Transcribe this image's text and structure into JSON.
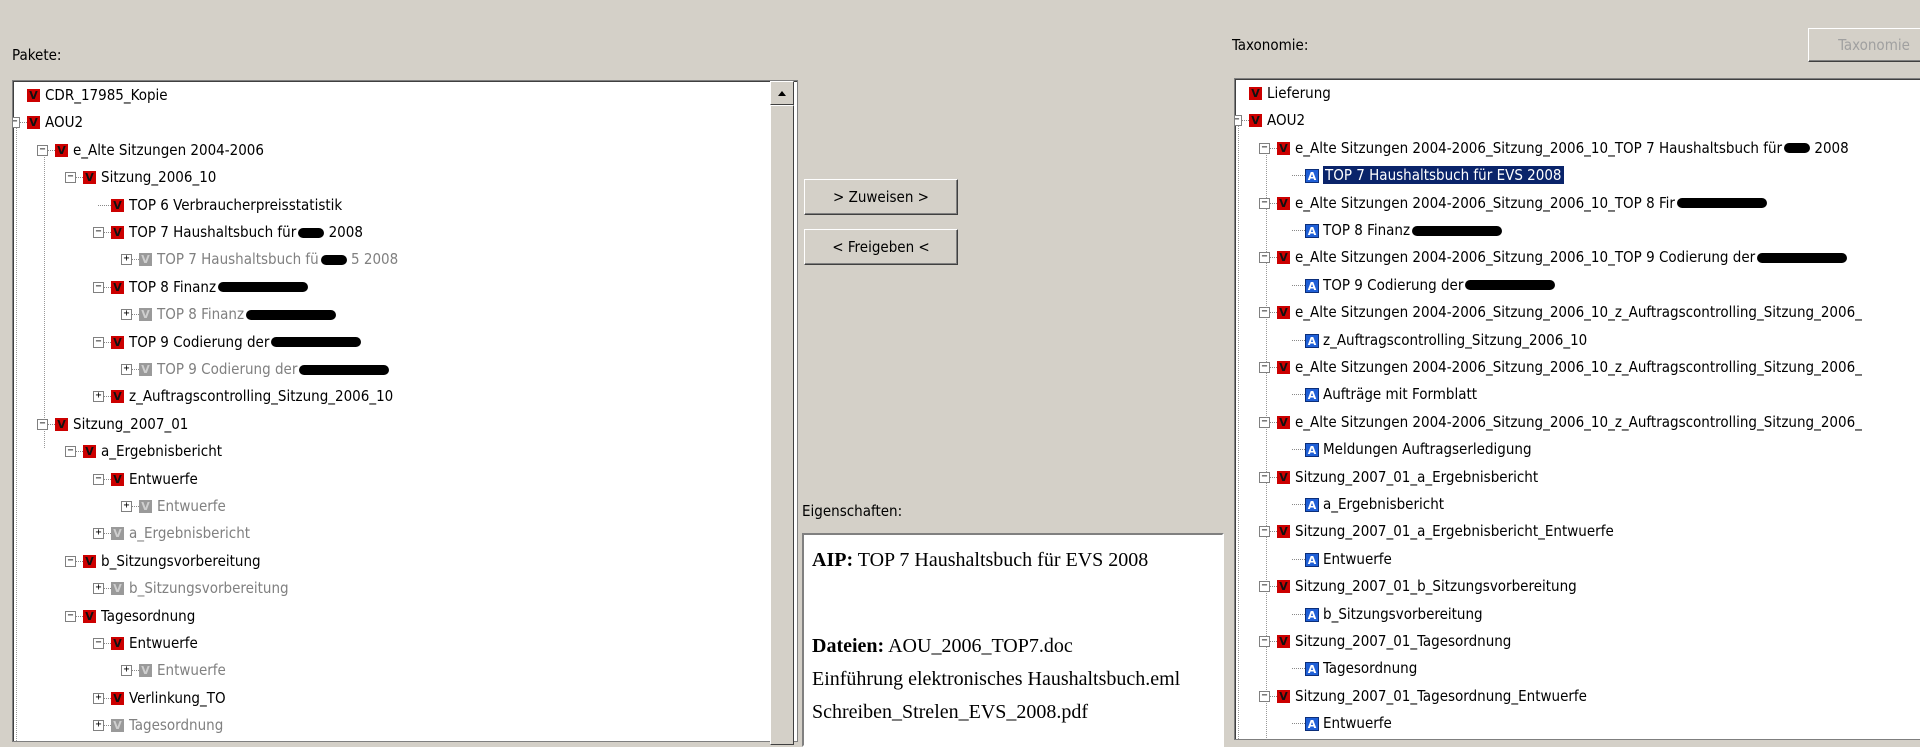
{
  "left_panel": {
    "label": "Pakete:",
    "tree": [
      {
        "t": "CDR_17985_Kopie",
        "i": "red",
        "c": "black"
      },
      {
        "t": "AOU2",
        "i": "red",
        "c": "black",
        "e": "-"
      },
      {
        "t": "e_Alte Sitzungen 2004-2006",
        "i": "red",
        "c": "black",
        "e": "-"
      },
      {
        "t": "Sitzung_2006_10",
        "i": "red",
        "c": "black",
        "e": "-"
      },
      {
        "t": "TOP 6 Verbraucherpreisstatistik",
        "i": "red",
        "c": "black"
      },
      {
        "t": "TOP 7 Haushaltsbuch für",
        "r": "2008",
        "i": "red",
        "c": "black",
        "e": "-"
      },
      {
        "t": "TOP 7 Haushaltsbuch fü",
        "r": "5 2008",
        "i": "gray",
        "c": "gray",
        "e": "+"
      },
      {
        "t": "TOP 8 Finanz",
        "r": "",
        "i": "red",
        "c": "black",
        "e": "-"
      },
      {
        "t": "TOP 8 Finanz",
        "r": "",
        "i": "gray",
        "c": "gray",
        "e": "+"
      },
      {
        "t": "TOP 9 Codierung der",
        "r": "",
        "i": "red",
        "c": "black",
        "e": "-"
      },
      {
        "t": "TOP 9 Codierung der",
        "r": "",
        "i": "gray",
        "c": "gray",
        "e": "+"
      },
      {
        "t": "z_Auftragscontrolling_Sitzung_2006_10",
        "i": "red",
        "c": "black",
        "e": "+"
      },
      {
        "t": "Sitzung_2007_01",
        "i": "red",
        "c": "black",
        "e": "-"
      },
      {
        "t": "a_Ergebnisbericht",
        "i": "red",
        "c": "black",
        "e": "-"
      },
      {
        "t": "Entwuerfe",
        "i": "red",
        "c": "black",
        "e": "-"
      },
      {
        "t": "Entwuerfe",
        "i": "gray",
        "c": "gray",
        "e": "+"
      },
      {
        "t": "a_Ergebnisbericht",
        "i": "gray",
        "c": "gray",
        "e": "+"
      },
      {
        "t": "b_Sitzungsvorbereitung",
        "i": "red",
        "c": "black",
        "e": "-"
      },
      {
        "t": "b_Sitzungsvorbereitung",
        "i": "gray",
        "c": "gray",
        "e": "+"
      },
      {
        "t": "Tagesordnung",
        "i": "red",
        "c": "black",
        "e": "-"
      },
      {
        "t": "Entwuerfe",
        "i": "red",
        "c": "black",
        "e": "-"
      },
      {
        "t": "Entwuerfe",
        "i": "gray",
        "c": "gray",
        "e": "+"
      },
      {
        "t": "Verlinkung_TO",
        "i": "red",
        "c": "black",
        "e": "+"
      },
      {
        "t": "Tagesordnung",
        "i": "gray",
        "c": "gray",
        "e": "+"
      }
    ]
  },
  "buttons": {
    "assign": "> Zuweisen >",
    "release": "< Freigeben <"
  },
  "properties": {
    "label": "Eigenschaften:",
    "aip_label": "AIP:",
    "aip_value": "TOP 7 Haushaltsbuch für EVS 2008",
    "files_label": "Dateien:",
    "files": [
      "AOU_2006_TOP7.doc",
      "Einführung elektronisches Haushaltsbuch.eml",
      "Schreiben_Strelen_EVS_2008.pdf"
    ]
  },
  "right_panel": {
    "label": "Taxonomie:",
    "button": "Taxonomie",
    "tree": [
      {
        "t": "Lieferung",
        "i": "red"
      },
      {
        "t": "AOU2",
        "i": "red",
        "e": "-"
      },
      {
        "t": "e_Alte Sitzungen 2004-2006_Sitzung_2006_10_TOP 7 Haushaltsbuch für",
        "r": "2008",
        "i": "red",
        "e": "-"
      },
      {
        "t": "TOP 7 Haushaltsbuch für EVS 2008",
        "i": "blue",
        "sel": true
      },
      {
        "t": "e_Alte Sitzungen 2004-2006_Sitzung_2006_10_TOP 8 Fir",
        "r": "",
        "i": "red",
        "e": "-"
      },
      {
        "t": "TOP 8 Finanz",
        "r": "",
        "i": "blue"
      },
      {
        "t": "e_Alte Sitzungen 2004-2006_Sitzung_2006_10_TOP 9 Codierung der",
        "r": "",
        "i": "red",
        "e": "-"
      },
      {
        "t": "TOP 9 Codierung der",
        "r": "",
        "i": "blue"
      },
      {
        "t": "e_Alte Sitzungen 2004-2006_Sitzung_2006_10_z_Auftragscontrolling_Sitzung_2006_",
        "i": "red",
        "e": "-"
      },
      {
        "t": "z_Auftragscontrolling_Sitzung_2006_10",
        "i": "blue"
      },
      {
        "t": "e_Alte Sitzungen 2004-2006_Sitzung_2006_10_z_Auftragscontrolling_Sitzung_2006_",
        "i": "red",
        "e": "-"
      },
      {
        "t": "Aufträge mit Formblatt",
        "i": "blue"
      },
      {
        "t": "e_Alte Sitzungen 2004-2006_Sitzung_2006_10_z_Auftragscontrolling_Sitzung_2006_",
        "i": "red",
        "e": "-"
      },
      {
        "t": "Meldungen Auftragserledigung",
        "i": "blue"
      },
      {
        "t": "Sitzung_2007_01_a_Ergebnisbericht",
        "i": "red",
        "e": "-"
      },
      {
        "t": "a_Ergebnisbericht",
        "i": "blue"
      },
      {
        "t": "Sitzung_2007_01_a_Ergebnisbericht_Entwuerfe",
        "i": "red",
        "e": "-"
      },
      {
        "t": "Entwuerfe",
        "i": "blue"
      },
      {
        "t": "Sitzung_2007_01_b_Sitzungsvorbereitung",
        "i": "red",
        "e": "-"
      },
      {
        "t": "b_Sitzungsvorbereitung",
        "i": "blue"
      },
      {
        "t": "Sitzung_2007_01_Tagesordnung",
        "i": "red",
        "e": "-"
      },
      {
        "t": "Tagesordnung",
        "i": "blue"
      },
      {
        "t": "Sitzung_2007_01_Tagesordnung_Entwuerfe",
        "i": "red",
        "e": "-"
      },
      {
        "t": "Entwuerfe",
        "i": "blue"
      }
    ]
  }
}
